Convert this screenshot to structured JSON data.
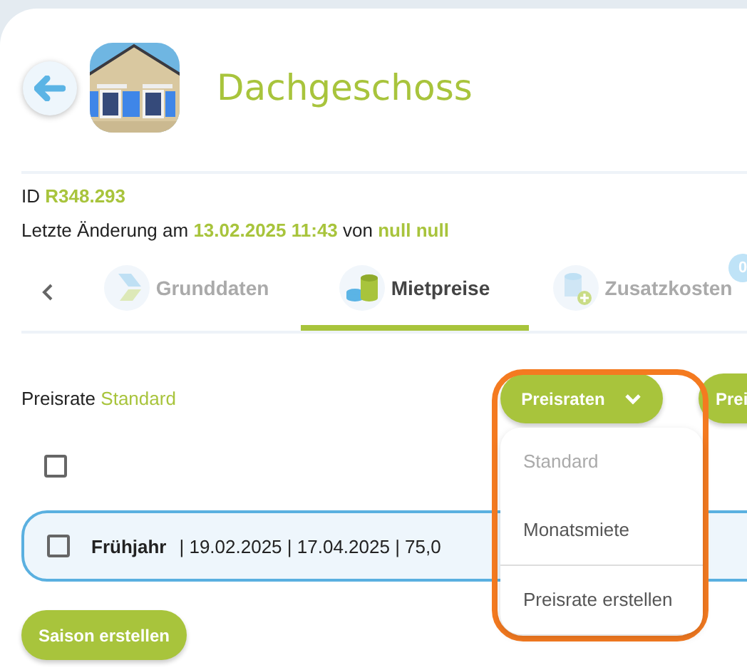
{
  "header": {
    "title": "Dachgeschoss"
  },
  "info": {
    "id_label": "ID",
    "id": "R348.293",
    "changed": "Letzte Änderung am **13.02.2025 11:43** von **null null**"
  },
  "tabs": [
    {
      "label": "Grunddaten",
      "kind": "basics",
      "selected": false
    },
    {
      "label": "Mietpreise",
      "kind": "prices",
      "selected": true
    },
    {
      "label": "Zusatzkosten",
      "kind": "extras",
      "selected": false,
      "badge": "0"
    }
  ],
  "rate": {
    "label": "Preisrate",
    "value": "Standard"
  },
  "actions": [
    {
      "label": "Preisraten",
      "kind": "dropdown"
    },
    {
      "label": "Prei",
      "kind": "plain"
    }
  ],
  "select_all": {
    "checked": false
  },
  "seasons": [
    {
      "name": "Frühjahr",
      "details": "| 19.02.2025 | 17.04.2025 | 75,0",
      "checked": false
    }
  ],
  "create_button": "Saison erstellen",
  "menu": {
    "items": [
      {
        "label": "Standard",
        "disabled": true,
        "divider_before": false
      },
      {
        "label": "Monatsmiete",
        "disabled": false,
        "divider_before": false
      },
      {
        "label": "Preisrate erstellen",
        "disabled": false,
        "divider_before": true
      }
    ]
  }
}
